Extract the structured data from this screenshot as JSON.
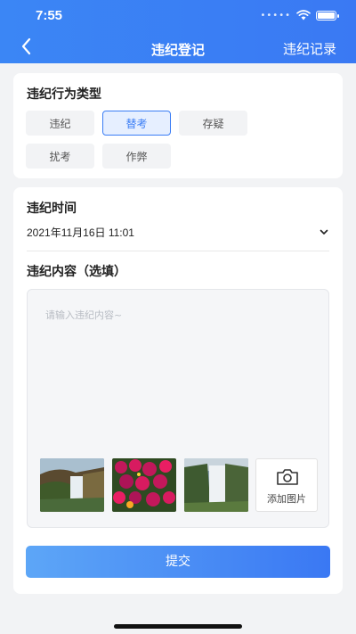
{
  "status_bar": {
    "time": "7:55",
    "signal": "•••••"
  },
  "nav": {
    "title": "违纪登记",
    "right_link": "违纪记录"
  },
  "violation_type": {
    "title": "违纪行为类型",
    "options": [
      "违纪",
      "替考",
      "存疑",
      "扰考",
      "作弊"
    ],
    "selected": "替考"
  },
  "violation_time": {
    "title": "违纪时间",
    "value": "2021年11月16日  11:01"
  },
  "violation_content": {
    "title": "违纪内容（选填）",
    "placeholder": "请输入违纪内容~",
    "images": [
      "waterfall-photo",
      "flowers-photo",
      "waterfall-photo"
    ],
    "add_photo_label": "添加图片"
  },
  "submit_label": "提交",
  "colors": {
    "primary": "#3a7df5",
    "background": "#f2f3f5"
  }
}
